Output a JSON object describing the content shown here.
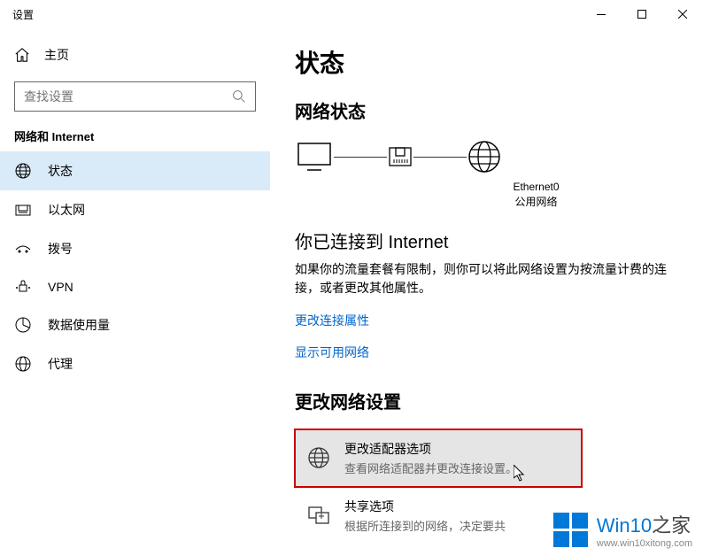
{
  "window": {
    "title": "设置"
  },
  "sidebar": {
    "home": "主页",
    "search_placeholder": "查找设置",
    "section": "网络和 Internet",
    "items": [
      {
        "label": "状态"
      },
      {
        "label": "以太网"
      },
      {
        "label": "拨号"
      },
      {
        "label": "VPN"
      },
      {
        "label": "数据使用量"
      },
      {
        "label": "代理"
      }
    ]
  },
  "main": {
    "heading": "状态",
    "network_status": "网络状态",
    "adapter_name": "Ethernet0",
    "adapter_type": "公用网络",
    "connected_title": "你已连接到 Internet",
    "connected_desc": "如果你的流量套餐有限制，则你可以将此网络设置为按流量计费的连接，或者更改其他属性。",
    "link_change_props": "更改连接属性",
    "link_show_networks": "显示可用网络",
    "change_settings": "更改网络设置",
    "card_adapter_title": "更改适配器选项",
    "card_adapter_desc": "查看网络适配器并更改连接设置。",
    "card_sharing_title": "共享选项",
    "card_sharing_desc": "根据所连接到的网络，决定要共"
  },
  "watermark": {
    "brand_a": "Win10",
    "brand_b": "之家",
    "url": "www.win10xitong.com"
  }
}
